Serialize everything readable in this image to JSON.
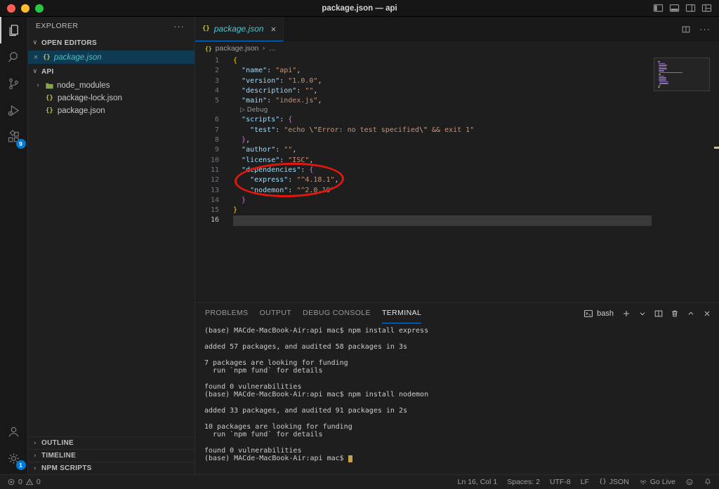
{
  "titlebar": {
    "title": "package.json — api"
  },
  "icons": {
    "json_braces": "{}",
    "more_horizontal": "···",
    "chevron_down": "∨",
    "chevron_right": "›",
    "close": "×",
    "breadcrumb_sep": "›",
    "ellipsis": "…"
  },
  "colors": {
    "key": "#9cdcfe",
    "str": "#ce9178",
    "esc": "#d7ba7d",
    "punc": "#d4d4d4",
    "b1": "#ffd700",
    "b2": "#da70d6",
    "codelens": "#999999",
    "mm_key": "#8a6fae",
    "mm_plain": "#9a8f6a"
  },
  "activity_bar": {
    "extensions_badge": "9",
    "settings_badge": "1"
  },
  "sidebar": {
    "title": "EXPLORER",
    "open_editors_label": "OPEN EDITORS",
    "open_editor_item": "package.json",
    "folder_label": "API",
    "files": [
      "node_modules",
      "package-lock.json",
      "package.json"
    ],
    "bottom_sections": [
      "OUTLINE",
      "TIMELINE",
      "NPM SCRIPTS"
    ]
  },
  "editor": {
    "tab_label": "package.json",
    "breadcrumb_file": "package.json",
    "lines": [
      {
        "n": "1",
        "tokens": [
          {
            "t": "{",
            "c": "b1"
          }
        ]
      },
      {
        "n": "2",
        "tokens": [
          {
            "t": "  ",
            "c": "punc"
          },
          {
            "t": "\"name\"",
            "c": "key"
          },
          {
            "t": ": ",
            "c": "punc"
          },
          {
            "t": "\"api\"",
            "c": "str"
          },
          {
            "t": ",",
            "c": "punc"
          }
        ]
      },
      {
        "n": "3",
        "tokens": [
          {
            "t": "  ",
            "c": "punc"
          },
          {
            "t": "\"version\"",
            "c": "key"
          },
          {
            "t": ": ",
            "c": "punc"
          },
          {
            "t": "\"1.0.0\"",
            "c": "str"
          },
          {
            "t": ",",
            "c": "punc"
          }
        ]
      },
      {
        "n": "4",
        "tokens": [
          {
            "t": "  ",
            "c": "punc"
          },
          {
            "t": "\"description\"",
            "c": "key"
          },
          {
            "t": ": ",
            "c": "punc"
          },
          {
            "t": "\"\"",
            "c": "str"
          },
          {
            "t": ",",
            "c": "punc"
          }
        ]
      },
      {
        "n": "5",
        "tokens": [
          {
            "t": "  ",
            "c": "punc"
          },
          {
            "t": "\"main\"",
            "c": "key"
          },
          {
            "t": ": ",
            "c": "punc"
          },
          {
            "t": "\"index.js\"",
            "c": "str"
          },
          {
            "t": ",",
            "c": "punc"
          }
        ]
      },
      {
        "n": "",
        "cls": "codelens",
        "tokens": [
          {
            "t": "▷ Debug",
            "c": "codelens"
          }
        ]
      },
      {
        "n": "6",
        "tokens": [
          {
            "t": "  ",
            "c": "punc"
          },
          {
            "t": "\"scripts\"",
            "c": "key"
          },
          {
            "t": ": ",
            "c": "punc"
          },
          {
            "t": "{",
            "c": "b2"
          }
        ]
      },
      {
        "n": "7",
        "tokens": [
          {
            "t": "    ",
            "c": "punc"
          },
          {
            "t": "\"test\"",
            "c": "key"
          },
          {
            "t": ": ",
            "c": "punc"
          },
          {
            "t": "\"echo ",
            "c": "str"
          },
          {
            "t": "\\\"",
            "c": "esc"
          },
          {
            "t": "Error: no test specified",
            "c": "str"
          },
          {
            "t": "\\\"",
            "c": "esc"
          },
          {
            "t": " && exit 1\"",
            "c": "str"
          }
        ]
      },
      {
        "n": "8",
        "tokens": [
          {
            "t": "  ",
            "c": "punc"
          },
          {
            "t": "}",
            "c": "b2"
          },
          {
            "t": ",",
            "c": "punc"
          }
        ]
      },
      {
        "n": "9",
        "tokens": [
          {
            "t": "  ",
            "c": "punc"
          },
          {
            "t": "\"author\"",
            "c": "key"
          },
          {
            "t": ": ",
            "c": "punc"
          },
          {
            "t": "\"\"",
            "c": "str"
          },
          {
            "t": ",",
            "c": "punc"
          }
        ]
      },
      {
        "n": "10",
        "tokens": [
          {
            "t": "  ",
            "c": "punc"
          },
          {
            "t": "\"license\"",
            "c": "key"
          },
          {
            "t": ": ",
            "c": "punc"
          },
          {
            "t": "\"ISC\"",
            "c": "str"
          },
          {
            "t": ",",
            "c": "punc"
          }
        ]
      },
      {
        "n": "11",
        "tokens": [
          {
            "t": "  ",
            "c": "punc"
          },
          {
            "t": "\"dependencies\"",
            "c": "key"
          },
          {
            "t": ": ",
            "c": "punc"
          },
          {
            "t": "{",
            "c": "b2"
          }
        ]
      },
      {
        "n": "12",
        "tokens": [
          {
            "t": "    ",
            "c": "punc"
          },
          {
            "t": "\"express\"",
            "c": "key"
          },
          {
            "t": ": ",
            "c": "punc"
          },
          {
            "t": "\"^4.18.1\"",
            "c": "str"
          },
          {
            "t": ",",
            "c": "punc"
          }
        ]
      },
      {
        "n": "13",
        "tokens": [
          {
            "t": "    ",
            "c": "punc"
          },
          {
            "t": "\"nodemon\"",
            "c": "key"
          },
          {
            "t": ": ",
            "c": "punc"
          },
          {
            "t": "\"^2.0.19\"",
            "c": "str"
          }
        ]
      },
      {
        "n": "14",
        "tokens": [
          {
            "t": "  ",
            "c": "punc"
          },
          {
            "t": "}",
            "c": "b2"
          }
        ]
      },
      {
        "n": "15",
        "tokens": [
          {
            "t": "}",
            "c": "b1"
          }
        ]
      },
      {
        "n": "16",
        "cls": "active",
        "tokens": []
      }
    ]
  },
  "panel": {
    "tabs": [
      "PROBLEMS",
      "OUTPUT",
      "DEBUG CONSOLE",
      "TERMINAL"
    ],
    "shell_name": "bash",
    "terminal_lines": [
      "(base) MACde-MacBook-Air:api mac$ npm install express",
      "",
      "added 57 packages, and audited 58 packages in 3s",
      "",
      "7 packages are looking for funding",
      "  run `npm fund` for details",
      "",
      "found 0 vulnerabilities",
      "(base) MACde-MacBook-Air:api mac$ npm install nodemon",
      "",
      "added 33 packages, and audited 91 packages in 2s",
      "",
      "10 packages are looking for funding",
      "  run `npm fund` for details",
      "",
      "found 0 vulnerabilities",
      "(base) MACde-MacBook-Air:api mac$ "
    ]
  },
  "status_bar": {
    "errors": "0",
    "warnings": "0",
    "cursor_position": "Ln 16, Col 1",
    "indentation": "Spaces: 2",
    "encoding": "UTF-8",
    "eol": "LF",
    "language": "JSON",
    "go_live": "Go Live"
  }
}
